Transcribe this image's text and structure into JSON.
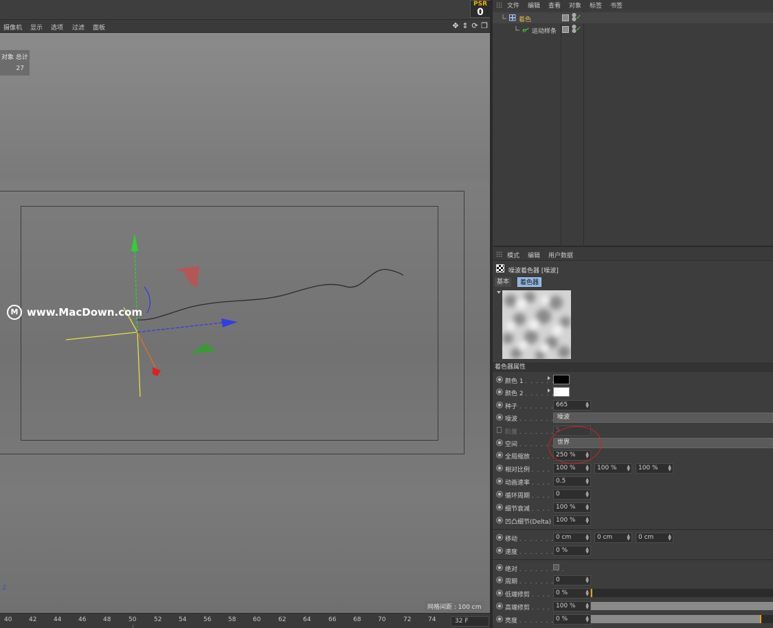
{
  "psr": {
    "label": "PSR",
    "value": "0"
  },
  "viewport_menu": [
    "摄像机",
    "显示",
    "选项",
    "过滤",
    "面板"
  ],
  "viewport": {
    "stats_header": "对象 总计",
    "stats_value": "27",
    "watermark": "www.MacDown.com",
    "watermark_logo": "M",
    "axis_z": "Z",
    "grid_info": "网格间距 : 100 cm",
    "controls": [
      "move-icon",
      "zoom-icon",
      "rotate-icon",
      "maximize-icon"
    ]
  },
  "timeline": {
    "ticks": [
      "40",
      "42",
      "44",
      "46",
      "48",
      "50",
      "52",
      "54",
      "56",
      "58",
      "60",
      "62",
      "64",
      "66",
      "68",
      "70",
      "72",
      "74"
    ],
    "frame": "32 F"
  },
  "object_manager": {
    "menu": [
      "文件",
      "编辑",
      "查看",
      "对象",
      "标签",
      "书签"
    ],
    "objects": [
      {
        "name": "着色",
        "color": "#e8b84a",
        "icon": "cloner-icon"
      },
      {
        "name": "运动样条",
        "color": "#cfcfcf",
        "icon": "mospline-icon"
      }
    ]
  },
  "attribute_manager": {
    "menu": [
      "模式",
      "编辑",
      "用户数据"
    ],
    "title": "噪波着色器 [噪波]",
    "tabs": [
      "基本",
      "着色器"
    ],
    "section": "着色器属性",
    "rows": {
      "color1": {
        "label": "颜色 1",
        "dots": ". . . . . .",
        "value": "#000000"
      },
      "color2": {
        "label": "颜色 2",
        "dots": ". . . . . .",
        "value": "#ffffff"
      },
      "seed": {
        "label": "种子",
        "dots": ". . . . . . . . .",
        "value": "665"
      },
      "noise": {
        "label": "噪波",
        "dots": ". . . . . . . . .",
        "value": "噪波"
      },
      "octaves": {
        "label": "阶度",
        "dots": ". . . . . . . . .",
        "value": "5"
      },
      "space": {
        "label": "空间",
        "dots": ". . . . . . . . .",
        "value": "世界"
      },
      "global_scale": {
        "label": "全局缩放",
        "dots": ". . . . . .",
        "value": "250 %"
      },
      "relative_scale": {
        "label": "相对比例",
        "dots": ". . . . . .",
        "values": [
          "100 %",
          "100 %",
          "100 %"
        ]
      },
      "anim_speed": {
        "label": "动画速率",
        "dots": ". . . . . .",
        "value": "0.5"
      },
      "loop_period": {
        "label": "循环周期",
        "dots": ". . . . . .",
        "value": "0"
      },
      "detail_atten": {
        "label": "细节衰减",
        "dots": ". . . . . .",
        "value": "100 %"
      },
      "bump_detail": {
        "label": "凹凸细节(Delta)",
        "value": "100 %"
      },
      "move": {
        "label": "移动",
        "dots": ". . . . . . . . .",
        "values": [
          "0 cm",
          "0 cm",
          "0 cm"
        ]
      },
      "speed": {
        "label": "速度",
        "dots": ". . . . . . . . .",
        "value": "0 %"
      },
      "absolute": {
        "label": "绝对",
        "dots": ". . . . . . . . .",
        "checked": false
      },
      "period": {
        "label": "周期",
        "dots": ". . . . . . . . .",
        "value": "0"
      },
      "low_clip": {
        "label": "低端修剪",
        "dots": ". . . . . .",
        "value": "0 %",
        "fraction": 0.0
      },
      "high_clip": {
        "label": "高端修剪",
        "dots": ". . . . . .",
        "value": "100 %",
        "fraction": 1.0
      },
      "brightness": {
        "label": "亮度",
        "dots": ". . . . . . . . .",
        "value": "0 %",
        "fraction": 0.93
      }
    }
  },
  "colors": {
    "accent_selected": "#e8b84a",
    "tab_active": "#8fb4e0",
    "annotation": "#d02020",
    "axis_x": "#3040e0",
    "axis_y": "#20c020",
    "axis_z": "#e02020"
  }
}
